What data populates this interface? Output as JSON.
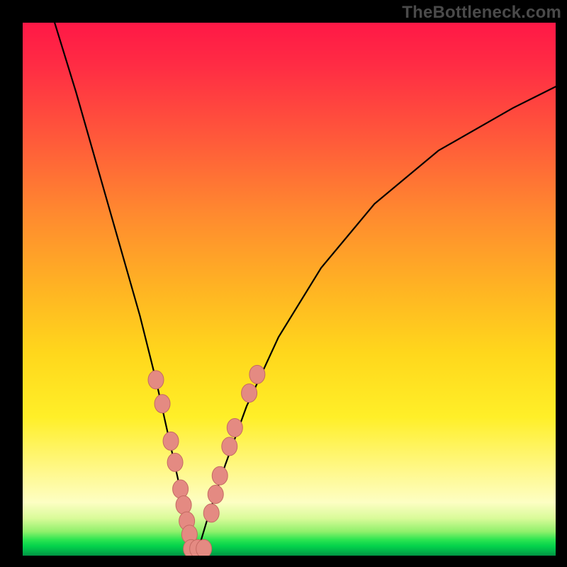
{
  "watermark": "TheBottleneck.com",
  "colors": {
    "curve_stroke": "#000000",
    "marker_fill": "#e48a82",
    "marker_stroke": "#c46a62",
    "frame": "#000000"
  },
  "chart_data": {
    "type": "line",
    "title": "",
    "xlabel": "",
    "ylabel": "",
    "xlim": [
      0,
      100
    ],
    "ylim": [
      0,
      100
    ],
    "note": "Decorative bottleneck V-curve on a red-to-green gradient. No axes, ticks, or numeric labels are present; x/y values below are estimated from pixel positions on a 0–100 normalized scale (y=0 at bottom).",
    "series": [
      {
        "name": "bottleneck-curve",
        "x": [
          6,
          10,
          14,
          18,
          22,
          25,
          27,
          29,
          30.5,
          31.5,
          32.5,
          33.5,
          35,
          38,
          42,
          48,
          56,
          66,
          78,
          92,
          100
        ],
        "y": [
          100,
          87,
          73,
          59,
          45,
          33,
          24,
          15,
          8,
          3,
          0.5,
          3,
          8,
          17,
          28,
          41,
          54,
          66,
          76,
          84,
          88
        ]
      }
    ],
    "markers": [
      {
        "x": 25.0,
        "y": 33.0
      },
      {
        "x": 26.2,
        "y": 28.5
      },
      {
        "x": 27.8,
        "y": 21.5
      },
      {
        "x": 28.6,
        "y": 17.5
      },
      {
        "x": 29.6,
        "y": 12.5
      },
      {
        "x": 30.2,
        "y": 9.5
      },
      {
        "x": 30.8,
        "y": 6.5
      },
      {
        "x": 31.3,
        "y": 4.0
      },
      {
        "x": 31.6,
        "y": 1.3
      },
      {
        "x": 32.8,
        "y": 1.3
      },
      {
        "x": 34.0,
        "y": 1.3
      },
      {
        "x": 35.4,
        "y": 8.0
      },
      {
        "x": 36.2,
        "y": 11.5
      },
      {
        "x": 37.0,
        "y": 15.0
      },
      {
        "x": 38.8,
        "y": 20.5
      },
      {
        "x": 39.8,
        "y": 24.0
      },
      {
        "x": 42.5,
        "y": 30.5
      },
      {
        "x": 44.0,
        "y": 34.0
      }
    ]
  }
}
